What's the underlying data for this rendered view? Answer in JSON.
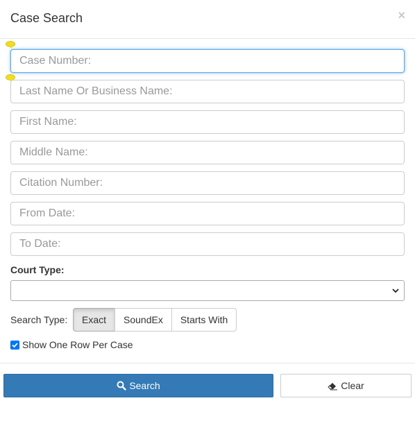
{
  "header": {
    "title": "Case Search",
    "close_glyph": "×",
    "close_icon": "close-icon"
  },
  "fields": {
    "case_number": "Case Number:",
    "last_name": "Last Name Or Business Name:",
    "first_name": "First Name:",
    "middle_name": "Middle Name:",
    "citation_number": "Citation Number:",
    "from_date": "From Date:",
    "to_date": "To Date:"
  },
  "court_type": {
    "label": "Court Type:",
    "selected": ""
  },
  "search_type": {
    "label": "Search Type:",
    "options": [
      "Exact",
      "SoundEx",
      "Starts With"
    ],
    "selected": "Exact"
  },
  "options": {
    "one_row_label": "Show One Row Per Case",
    "one_row_checked": true
  },
  "actions": {
    "search_label": "Search",
    "search_icon": "search-icon",
    "clear_label": "Clear",
    "clear_icon": "eraser-icon"
  },
  "colors": {
    "primary": "#337ab7",
    "focus": "#66afe9",
    "marker": "#f0de1f",
    "checkbox": "#0075ff"
  }
}
